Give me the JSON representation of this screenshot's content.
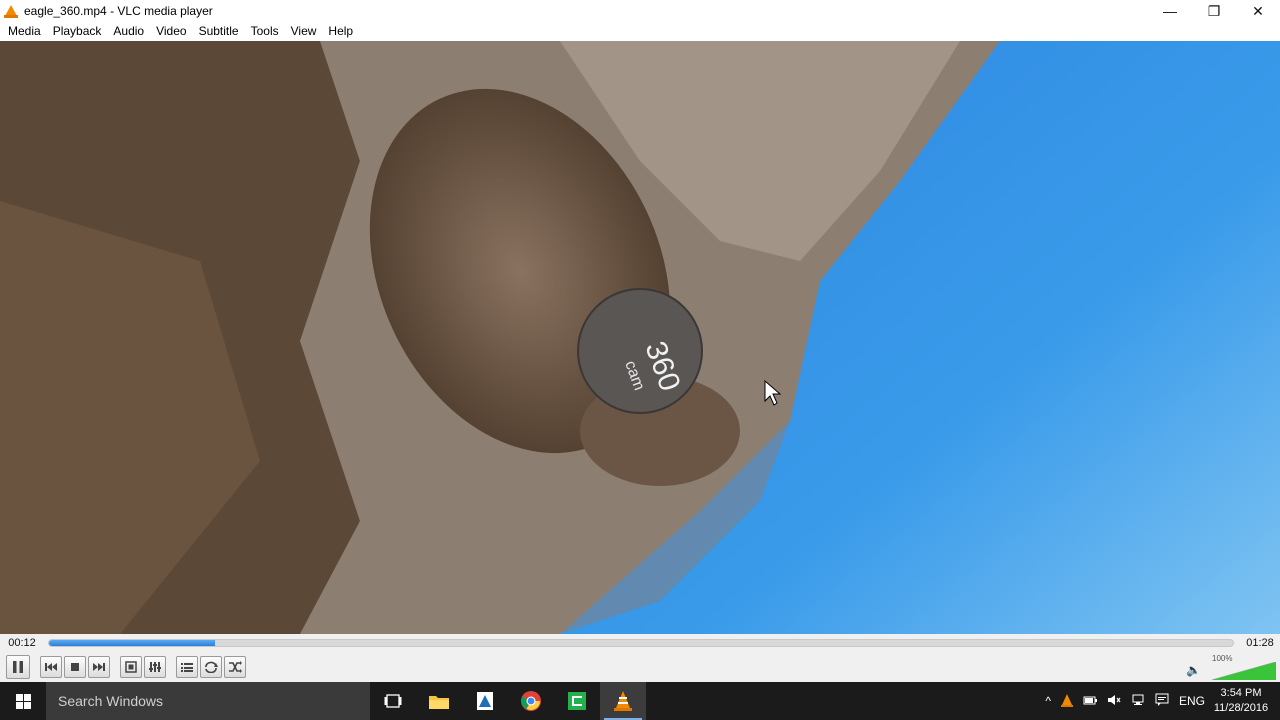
{
  "window": {
    "title": "eagle_360.mp4 - VLC media player",
    "controls": {
      "minimize": "—",
      "restore": "❐",
      "close": "✕"
    }
  },
  "menu": [
    "Media",
    "Playback",
    "Audio",
    "Video",
    "Subtitle",
    "Tools",
    "View",
    "Help"
  ],
  "video": {
    "overlay_logo_line1": "360",
    "overlay_logo_line2": "cam"
  },
  "seek": {
    "elapsed": "00:12",
    "total": "01:28",
    "progress": 0.14
  },
  "volume": {
    "percent_label": "100%",
    "level": 1.0
  },
  "taskbar": {
    "search_placeholder": "Search Windows",
    "language": "ENG",
    "time": "3:54 PM",
    "date": "11/28/2016"
  },
  "colors": {
    "seek_fill": "#2a80d8",
    "volume_fill": "#39c43a",
    "taskbar_bg": "#1b1b1b",
    "vlc_orange": "#f08a00"
  }
}
